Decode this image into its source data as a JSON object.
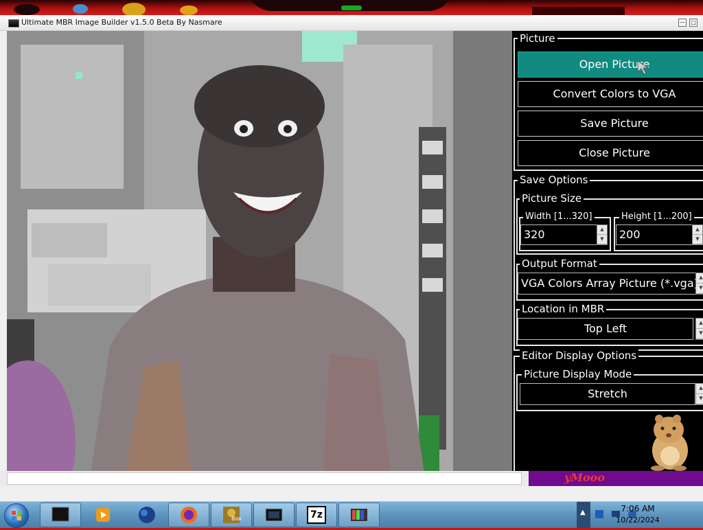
{
  "window": {
    "title": "Ultimate MBR Image Builder v1.5.0 Beta By Nasmare",
    "controls": {
      "minimize": "—",
      "maximize": "□"
    }
  },
  "panel": {
    "picture_group": {
      "label": "Picture",
      "buttons": [
        {
          "label": "Open Picture",
          "active": true
        },
        {
          "label": "Convert Colors to VGA",
          "active": false
        },
        {
          "label": "Save Picture",
          "active": false
        },
        {
          "label": "Close Picture",
          "active": false
        }
      ]
    },
    "save_options": {
      "label": "Save Options",
      "picture_size": {
        "label": "Picture Size",
        "width": {
          "label": "Width [1...320]",
          "value": "320"
        },
        "height": {
          "label": "Height [1...200]",
          "value": "200"
        }
      },
      "output_format": {
        "label": "Output Format",
        "value": "VGA Colors Array Picture (*.vga)"
      },
      "location": {
        "label": "Location in MBR",
        "value": "Top Left"
      }
    },
    "editor_display": {
      "label": "Editor Display Options",
      "display_mode": {
        "label": "Picture Display Mode",
        "value": "Stretch"
      }
    }
  },
  "statusbar": {
    "banner_text": "yMooo"
  },
  "taskbar": {
    "items": [
      {
        "name": "terminal-app",
        "icon": "monitor-icon"
      },
      {
        "name": "media-player",
        "icon": "play-icon"
      },
      {
        "name": "globe-app",
        "icon": "globe-icon"
      },
      {
        "name": "firefox",
        "icon": "firefox-icon"
      },
      {
        "name": "bonzi-box",
        "icon": "box-icon",
        "label": "Box"
      },
      {
        "name": "app-window",
        "icon": "window-icon"
      },
      {
        "name": "7zip",
        "icon": "7z-icon",
        "label": "7z"
      },
      {
        "name": "mbr-builder",
        "icon": "picture-icon"
      }
    ],
    "clock": {
      "time": "7:06 AM",
      "date": "10/22/2024"
    }
  },
  "colors": {
    "desktop_red": "#c41818",
    "panel_bg": "#000000",
    "active_button": "#118a80",
    "status_purple": "#6f0b8c",
    "taskbar_blue": "#5e93bd"
  }
}
